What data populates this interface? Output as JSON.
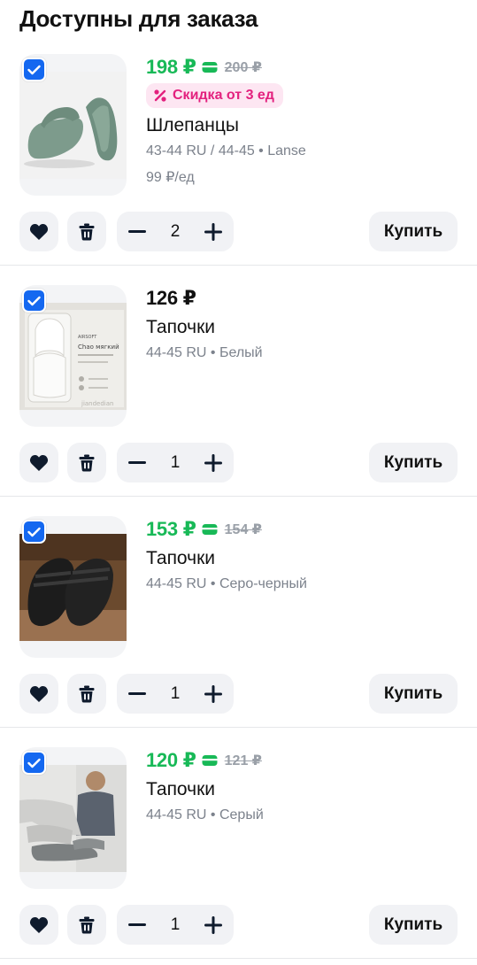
{
  "page": {
    "title": "Доступны для заказа"
  },
  "colors": {
    "accent_blue": "#1468f0",
    "price_green": "#18b957",
    "discount_pink": "#e3217e"
  },
  "items": [
    {
      "price": "198 ₽",
      "old_price": "200 ₽",
      "wallet_price": true,
      "discount": "Скидка от 3 ед",
      "name": "Шлепанцы",
      "variant": "43-44 RU / 44-45 • Lanse",
      "unit_price": "99 ₽/ед",
      "quantity": "2",
      "buy_label": "Купить",
      "image": "green-slide-sandals"
    },
    {
      "price": "126 ₽",
      "old_price": "",
      "wallet_price": false,
      "discount": "",
      "name": "Тапочки",
      "variant": "44-45 RU • Белый",
      "unit_price": "",
      "quantity": "1",
      "buy_label": "Купить",
      "image": "white-slippers-box",
      "image_text": {
        "brand": "AIRSOFT",
        "model": "Chao мягкий",
        "watermark": "jiandedian"
      }
    },
    {
      "price": "153 ₽",
      "old_price": "154 ₽",
      "wallet_price": true,
      "discount": "",
      "name": "Тапочки",
      "variant": "44-45 RU • Серо-черный",
      "unit_price": "",
      "quantity": "1",
      "buy_label": "Купить",
      "image": "black-slippers-pair"
    },
    {
      "price": "120 ₽",
      "old_price": "121 ₽",
      "wallet_price": true,
      "discount": "",
      "name": "Тапочки",
      "variant": "44-45 RU • Серый",
      "unit_price": "",
      "quantity": "1",
      "buy_label": "Купить",
      "image": "grey-slippers-model"
    }
  ]
}
